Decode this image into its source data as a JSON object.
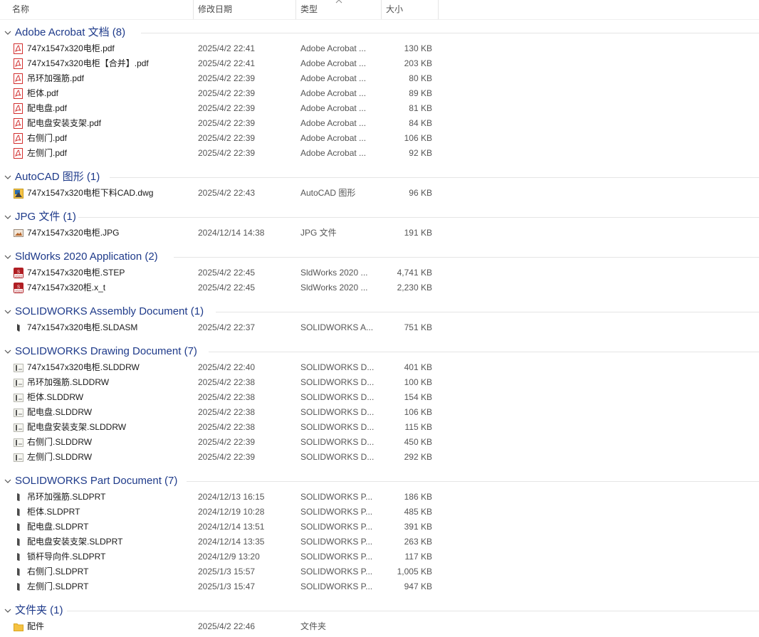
{
  "columns": {
    "name": "名称",
    "date": "修改日期",
    "type": "类型",
    "size": "大小"
  },
  "groups": [
    {
      "title": "Adobe Acrobat 文档 (8)",
      "icon": "pdf-icon",
      "rows": [
        {
          "name": "747x1547x320电柜.pdf",
          "date": "2025/4/2 22:41",
          "type": "Adobe Acrobat ...",
          "size": "130 KB"
        },
        {
          "name": "747x1547x320电柜【合并】.pdf",
          "date": "2025/4/2 22:41",
          "type": "Adobe Acrobat ...",
          "size": "203 KB"
        },
        {
          "name": "吊环加强筋.pdf",
          "date": "2025/4/2 22:39",
          "type": "Adobe Acrobat ...",
          "size": "80 KB"
        },
        {
          "name": "柜体.pdf",
          "date": "2025/4/2 22:39",
          "type": "Adobe Acrobat ...",
          "size": "89 KB"
        },
        {
          "name": "配电盘.pdf",
          "date": "2025/4/2 22:39",
          "type": "Adobe Acrobat ...",
          "size": "81 KB"
        },
        {
          "name": "配电盘安装支架.pdf",
          "date": "2025/4/2 22:39",
          "type": "Adobe Acrobat ...",
          "size": "84 KB"
        },
        {
          "name": "右侧门.pdf",
          "date": "2025/4/2 22:39",
          "type": "Adobe Acrobat ...",
          "size": "106 KB"
        },
        {
          "name": "左侧门.pdf",
          "date": "2025/4/2 22:39",
          "type": "Adobe Acrobat ...",
          "size": "92 KB"
        }
      ]
    },
    {
      "title": "AutoCAD 图形 (1)",
      "icon": "dwg-icon",
      "rows": [
        {
          "name": "747x1547x320电柜下料CAD.dwg",
          "date": "2025/4/2 22:43",
          "type": "AutoCAD 图形",
          "size": "96 KB"
        }
      ]
    },
    {
      "title": "JPG 文件 (1)",
      "icon": "jpg-icon",
      "rows": [
        {
          "name": "747x1547x320电柜.JPG",
          "date": "2024/12/14 14:38",
          "type": "JPG 文件",
          "size": "191 KB"
        }
      ]
    },
    {
      "title": "SldWorks 2020 Application (2)",
      "icon": "sldworks-icon",
      "rows": [
        {
          "name": "747x1547x320电柜.STEP",
          "date": "2025/4/2 22:45",
          "type": "SldWorks 2020 ...",
          "size": "4,741 KB"
        },
        {
          "name": "747x1547x320柜.x_t",
          "date": "2025/4/2 22:45",
          "type": "SldWorks 2020 ...",
          "size": "2,230 KB"
        }
      ]
    },
    {
      "title": "SOLIDWORKS Assembly Document (1)",
      "icon": "assembly-icon",
      "rows": [
        {
          "name": "747x1547x320电柜.SLDASM",
          "date": "2025/4/2 22:37",
          "type": "SOLIDWORKS A...",
          "size": "751 KB"
        }
      ]
    },
    {
      "title": "SOLIDWORKS Drawing Document (7)",
      "icon": "drawing-icon",
      "rows": [
        {
          "name": "747x1547x320电柜.SLDDRW",
          "date": "2025/4/2 22:40",
          "type": "SOLIDWORKS D...",
          "size": "401 KB"
        },
        {
          "name": "吊环加强筋.SLDDRW",
          "date": "2025/4/2 22:38",
          "type": "SOLIDWORKS D...",
          "size": "100 KB"
        },
        {
          "name": "柜体.SLDDRW",
          "date": "2025/4/2 22:38",
          "type": "SOLIDWORKS D...",
          "size": "154 KB"
        },
        {
          "name": "配电盘.SLDDRW",
          "date": "2025/4/2 22:38",
          "type": "SOLIDWORKS D...",
          "size": "106 KB"
        },
        {
          "name": "配电盘安装支架.SLDDRW",
          "date": "2025/4/2 22:38",
          "type": "SOLIDWORKS D...",
          "size": "115 KB"
        },
        {
          "name": "右侧门.SLDDRW",
          "date": "2025/4/2 22:39",
          "type": "SOLIDWORKS D...",
          "size": "450 KB"
        },
        {
          "name": "左侧门.SLDDRW",
          "date": "2025/4/2 22:39",
          "type": "SOLIDWORKS D...",
          "size": "292 KB"
        }
      ]
    },
    {
      "title": "SOLIDWORKS Part Document (7)",
      "icon": "part-icon",
      "rows": [
        {
          "name": "吊环加强筋.SLDPRT",
          "date": "2024/12/13 16:15",
          "type": "SOLIDWORKS P...",
          "size": "186 KB"
        },
        {
          "name": "柜体.SLDPRT",
          "date": "2024/12/19 10:28",
          "type": "SOLIDWORKS P...",
          "size": "485 KB"
        },
        {
          "name": "配电盘.SLDPRT",
          "date": "2024/12/14 13:51",
          "type": "SOLIDWORKS P...",
          "size": "391 KB"
        },
        {
          "name": "配电盘安装支架.SLDPRT",
          "date": "2024/12/14 13:35",
          "type": "SOLIDWORKS P...",
          "size": "263 KB"
        },
        {
          "name": "锁杆导向件.SLDPRT",
          "date": "2024/12/9 13:20",
          "type": "SOLIDWORKS P...",
          "size": "117 KB"
        },
        {
          "name": "右侧门.SLDPRT",
          "date": "2025/1/3 15:57",
          "type": "SOLIDWORKS P...",
          "size": "1,005 KB"
        },
        {
          "name": "左侧门.SLDPRT",
          "date": "2025/1/3 15:47",
          "type": "SOLIDWORKS P...",
          "size": "947 KB"
        }
      ]
    },
    {
      "title": "文件夹 (1)",
      "icon": "folder-icon",
      "rows": [
        {
          "name": "配件",
          "date": "2025/4/2 22:46",
          "type": "文件夹",
          "size": ""
        }
      ]
    }
  ],
  "colors": {
    "group_title": "#1e3a8a",
    "pdf_red": "#d32f2f",
    "folder_yellow": "#f5c242"
  }
}
